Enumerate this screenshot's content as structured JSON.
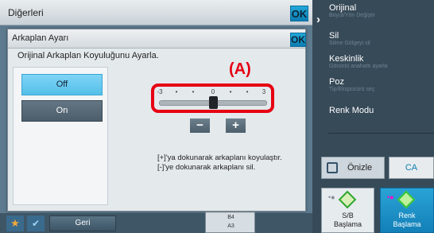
{
  "outer": {
    "title": "Diğerleri",
    "ok_label": "OK"
  },
  "right_panel": {
    "items": [
      {
        "label": "Orijinal",
        "sub": "Boyut/Yön Değiştir"
      },
      {
        "label": "Sil",
        "sub": "Silme Gölgeyi sil"
      },
      {
        "label": "Keskinlik",
        "sub": "Görüntü anahattı ayarla"
      },
      {
        "label": "Poz",
        "sub": "Tip/Ekspozürü seç"
      },
      {
        "label": "Renk Modu",
        "sub": ""
      }
    ],
    "preview_label": "Önizle",
    "ca_label": "CA",
    "bw_start": {
      "line1": "S/B",
      "line2": "Başlama"
    },
    "color_start": {
      "line1": "Renk",
      "line2": "Başlama"
    }
  },
  "bottom": {
    "back_label": "Geri",
    "paper": [
      "B4",
      "A3"
    ]
  },
  "dialog": {
    "title": "Arkaplan Ayarı",
    "ok_label": "OK",
    "message": "Orijinal Arkaplan Koyuluğunu Ayarla.",
    "options": {
      "off": "Off",
      "on": "On",
      "selected": "Off"
    },
    "slider": {
      "ticks": [
        "-3",
        "•",
        "•",
        "0",
        "•",
        "•",
        "3"
      ],
      "value": 0
    },
    "minus_label": "−",
    "plus_label": "+",
    "help_line1": "[+]'ya dokunarak arkaplanı koyulaştır.",
    "help_line2": "[-]'ye dokunarak arkaplanı sil."
  },
  "annotation": "(A)"
}
